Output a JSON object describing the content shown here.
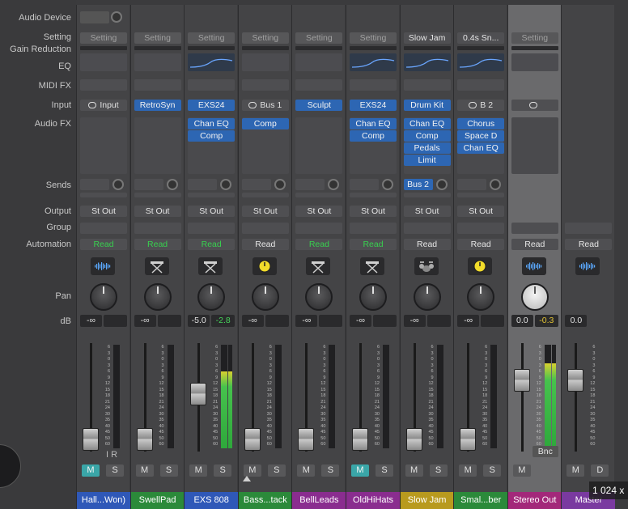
{
  "row_labels": {
    "audio_device": "Audio Device",
    "setting": "Setting",
    "gain_reduction": "Gain Reduction",
    "eq": "EQ",
    "midi_fx": "MIDI FX",
    "input": "Input",
    "audio_fx": "Audio FX",
    "sends": "Sends",
    "output": "Output",
    "group": "Group",
    "automation": "Automation",
    "pan": "Pan",
    "db": "dB"
  },
  "channels": [
    {
      "name": "Hall...Won)",
      "color": "#2f58b8",
      "setting": "Setting",
      "eq_active": false,
      "input": "Input",
      "input_type": "link",
      "fx": [],
      "send": "",
      "output": "St Out",
      "automation": "Read",
      "auto_color": "green",
      "icon": "waveform-icon",
      "db_left": "-∞",
      "db_right": "",
      "fader_level": 0.12,
      "meter_level": 0,
      "mute": "M",
      "solo": "S",
      "mute_on": true,
      "extra": "I R"
    },
    {
      "name": "SwellPad",
      "color": "#2b8a3a",
      "setting": "Setting",
      "eq_active": false,
      "input": "RetroSyn",
      "input_type": "plugin",
      "fx": [],
      "send": "",
      "output": "St Out",
      "automation": "Read",
      "auto_color": "green",
      "icon": "synth-stand-icon",
      "db_left": "-∞",
      "db_right": "",
      "fader_level": 0.12,
      "meter_level": 0,
      "mute": "M",
      "solo": "S",
      "mute_on": false
    },
    {
      "name": "EXS 808",
      "color": "#2f58b8",
      "setting": "Setting",
      "eq_active": true,
      "input": "EXS24",
      "input_type": "plugin",
      "fx": [
        "Chan EQ",
        "Comp"
      ],
      "send": "",
      "output": "St Out",
      "automation": "Read",
      "auto_color": "green",
      "icon": "synth-stand-icon",
      "db_left": "-5.0",
      "db_right": "-2.8",
      "fader_level": 0.56,
      "meter_level": 0.74,
      "mute": "M",
      "solo": "S",
      "mute_on": false
    },
    {
      "name": "Bass...tack",
      "color": "#2b8a3a",
      "setting": "Setting",
      "eq_active": false,
      "input": "Bus 1",
      "input_type": "link",
      "fx": [
        "Comp"
      ],
      "send": "",
      "output": "St Out",
      "automation": "Read",
      "auto_color": "white",
      "icon": "tuner-icon",
      "db_left": "-∞",
      "db_right": "",
      "fader_level": 0.12,
      "meter_level": 0,
      "mute": "M",
      "solo": "S",
      "mute_on": false
    },
    {
      "name": "BellLeads",
      "color": "#8a2d8f",
      "setting": "Setting",
      "eq_active": false,
      "input": "Sculpt",
      "input_type": "plugin",
      "fx": [],
      "send": "",
      "output": "St Out",
      "automation": "Read",
      "auto_color": "green",
      "icon": "synth-stand-icon",
      "db_left": "-∞",
      "db_right": "",
      "fader_level": 0.12,
      "meter_level": 0,
      "mute": "M",
      "solo": "S",
      "mute_on": false
    },
    {
      "name": "OldHiHats",
      "color": "#8a2d8f",
      "setting": "Setting",
      "eq_active": true,
      "input": "EXS24",
      "input_type": "plugin",
      "fx": [
        "Chan EQ",
        "Comp"
      ],
      "send": "",
      "output": "St Out",
      "automation": "Read",
      "auto_color": "green",
      "icon": "synth-stand-icon",
      "db_left": "-∞",
      "db_right": "",
      "fader_level": 0.12,
      "meter_level": 0,
      "mute": "M",
      "solo": "S",
      "mute_on": true
    },
    {
      "name": "Slow Jam",
      "color": "#b89a1e",
      "setting": "Slow Jam",
      "eq_active": true,
      "input": "Drum Kit",
      "input_type": "plugin",
      "fx": [
        "Chan EQ",
        "Comp",
        "Pedals",
        "Limit"
      ],
      "send": "Bus 2",
      "output": "St Out",
      "automation": "Read",
      "auto_color": "white",
      "icon": "drum-kit-icon",
      "db_left": "-∞",
      "db_right": "",
      "fader_level": 0.12,
      "meter_level": 0,
      "mute": "M",
      "solo": "S",
      "mute_on": false
    },
    {
      "name": "Smal...ber",
      "color": "#2b8a3a",
      "setting": "0.4s Sn...",
      "eq_active": true,
      "input": "B 2",
      "input_type": "link",
      "fx": [
        "Chorus",
        "Space D",
        "Chan EQ"
      ],
      "send": "",
      "output": "St Out",
      "automation": "Read",
      "auto_color": "white",
      "icon": "tuner-icon",
      "db_left": "-∞",
      "db_right": "",
      "fader_level": 0.12,
      "meter_level": 0,
      "mute": "M",
      "solo": "S",
      "mute_on": false
    },
    {
      "name": "Stereo Out",
      "color": "#a3287a",
      "setting": "Setting",
      "eq_active": false,
      "input": "",
      "input_type": "link",
      "fx": [],
      "send": "",
      "output": "",
      "automation": "Read",
      "auto_color": "white",
      "icon": "waveform-icon",
      "db_left": "0.0",
      "db_right": "-0.3",
      "fader_level": 0.7,
      "meter_level": 0.82,
      "mute": "M",
      "solo": "",
      "mute_on": false,
      "extra": "Bnc",
      "selected": true
    },
    {
      "name": "Master",
      "color": "#7a3aa0",
      "setting": "",
      "eq_active": false,
      "input": "",
      "input_type": "none",
      "fx": [],
      "send": "",
      "output": "",
      "automation": "Read",
      "auto_color": "white",
      "icon": "waveform-icon",
      "db_left": "0.0",
      "db_right": "",
      "fader_level": 0.7,
      "meter_level": 0,
      "mute": "M",
      "solo": "D",
      "mute_on": false
    }
  ],
  "scale_ticks": [
    "6",
    "3",
    "0",
    "3",
    "6",
    "9",
    "12",
    "15",
    "18",
    "21",
    "24",
    "30",
    "35",
    "40",
    "45",
    "50",
    "60"
  ],
  "overlay": {
    "badge": "1 024 x"
  }
}
